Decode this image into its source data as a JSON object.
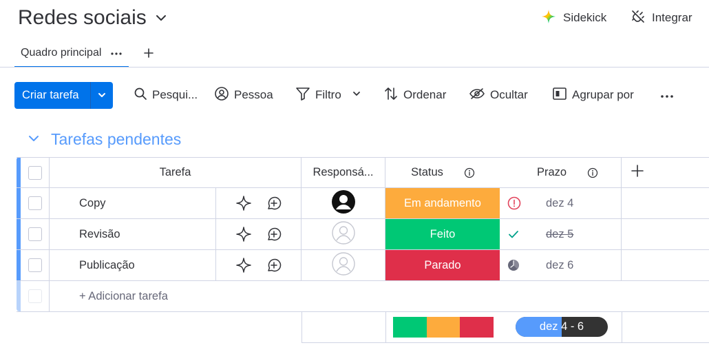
{
  "header": {
    "title": "Redes sociais",
    "sidekick_label": "Sidekick",
    "integrate_label": "Integrar"
  },
  "tabs": [
    {
      "label": "Quadro principal",
      "active": true
    }
  ],
  "toolbar": {
    "create_label": "Criar tarefa",
    "search_label": "Pesqui...",
    "person_label": "Pessoa",
    "filter_label": "Filtro",
    "sort_label": "Ordenar",
    "hide_label": "Ocultar",
    "group_label": "Agrupar por"
  },
  "group": {
    "title": "Tarefas pendentes",
    "color": "#579bfc"
  },
  "columns": {
    "task": "Tarefa",
    "owner": "Responsá...",
    "status": "Status",
    "deadline": "Prazo"
  },
  "rows": [
    {
      "task": "Copy",
      "owner": "filled-avatar",
      "status": "Em andamento",
      "status_color": "#fdab3d",
      "deadline_icon": "alert-icon",
      "deadline": "dez 4",
      "done": false
    },
    {
      "task": "Revisão",
      "owner": "empty-avatar",
      "status": "Feito",
      "status_color": "#00c875",
      "deadline_icon": "check-icon",
      "deadline": "dez 5",
      "done": true
    },
    {
      "task": "Publicação",
      "owner": "empty-avatar",
      "status": "Parado",
      "status_color": "#df2f4a",
      "deadline_icon": "clock-icon",
      "deadline": "dez 6",
      "done": false
    }
  ],
  "add_task_label": "+ Adicionar tarefa",
  "summary": {
    "status_distribution": [
      {
        "status": "Feito",
        "color": "#00c875",
        "fraction": 0.3333
      },
      {
        "status": "Em andamento",
        "color": "#fdab3d",
        "fraction": 0.3333
      },
      {
        "status": "Parado",
        "color": "#df2f4a",
        "fraction": 0.3333
      }
    ],
    "timeline_label_a": "dez ",
    "timeline_label_b": "4 - 6",
    "timeline_progress": 0.5
  },
  "colors": {
    "primary": "#0073ea",
    "border": "#d0d4e4",
    "text": "#323338"
  }
}
